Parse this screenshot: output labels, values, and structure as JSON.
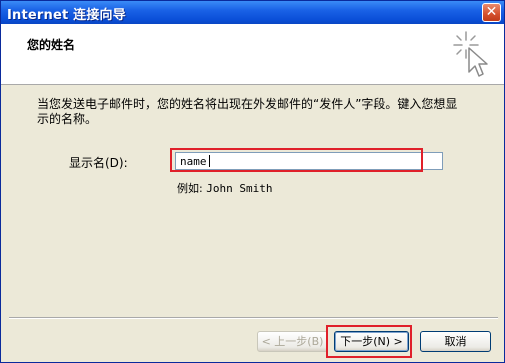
{
  "window": {
    "title": "Internet 连接向导",
    "close_symbol": "✕"
  },
  "header": {
    "title": "您的姓名",
    "icon": "wizard-sparkle-cursor-icon"
  },
  "body": {
    "description": "当您发送电子邮件时，您的姓名将出现在外发邮件的“发件人”字段。键入您想显示的名称。",
    "display_name_label": "显示名(D):",
    "display_name_value": "name",
    "example_prefix": "例如:",
    "example_value": "John Smith"
  },
  "buttons": {
    "back": "< 上一步(B)",
    "next": "下一步(N) >",
    "cancel": "取消",
    "back_enabled": false
  },
  "colors": {
    "title_bar": "#0b4fd8",
    "highlight": "#e0202a",
    "dialog_bg": "#ece9d8"
  }
}
